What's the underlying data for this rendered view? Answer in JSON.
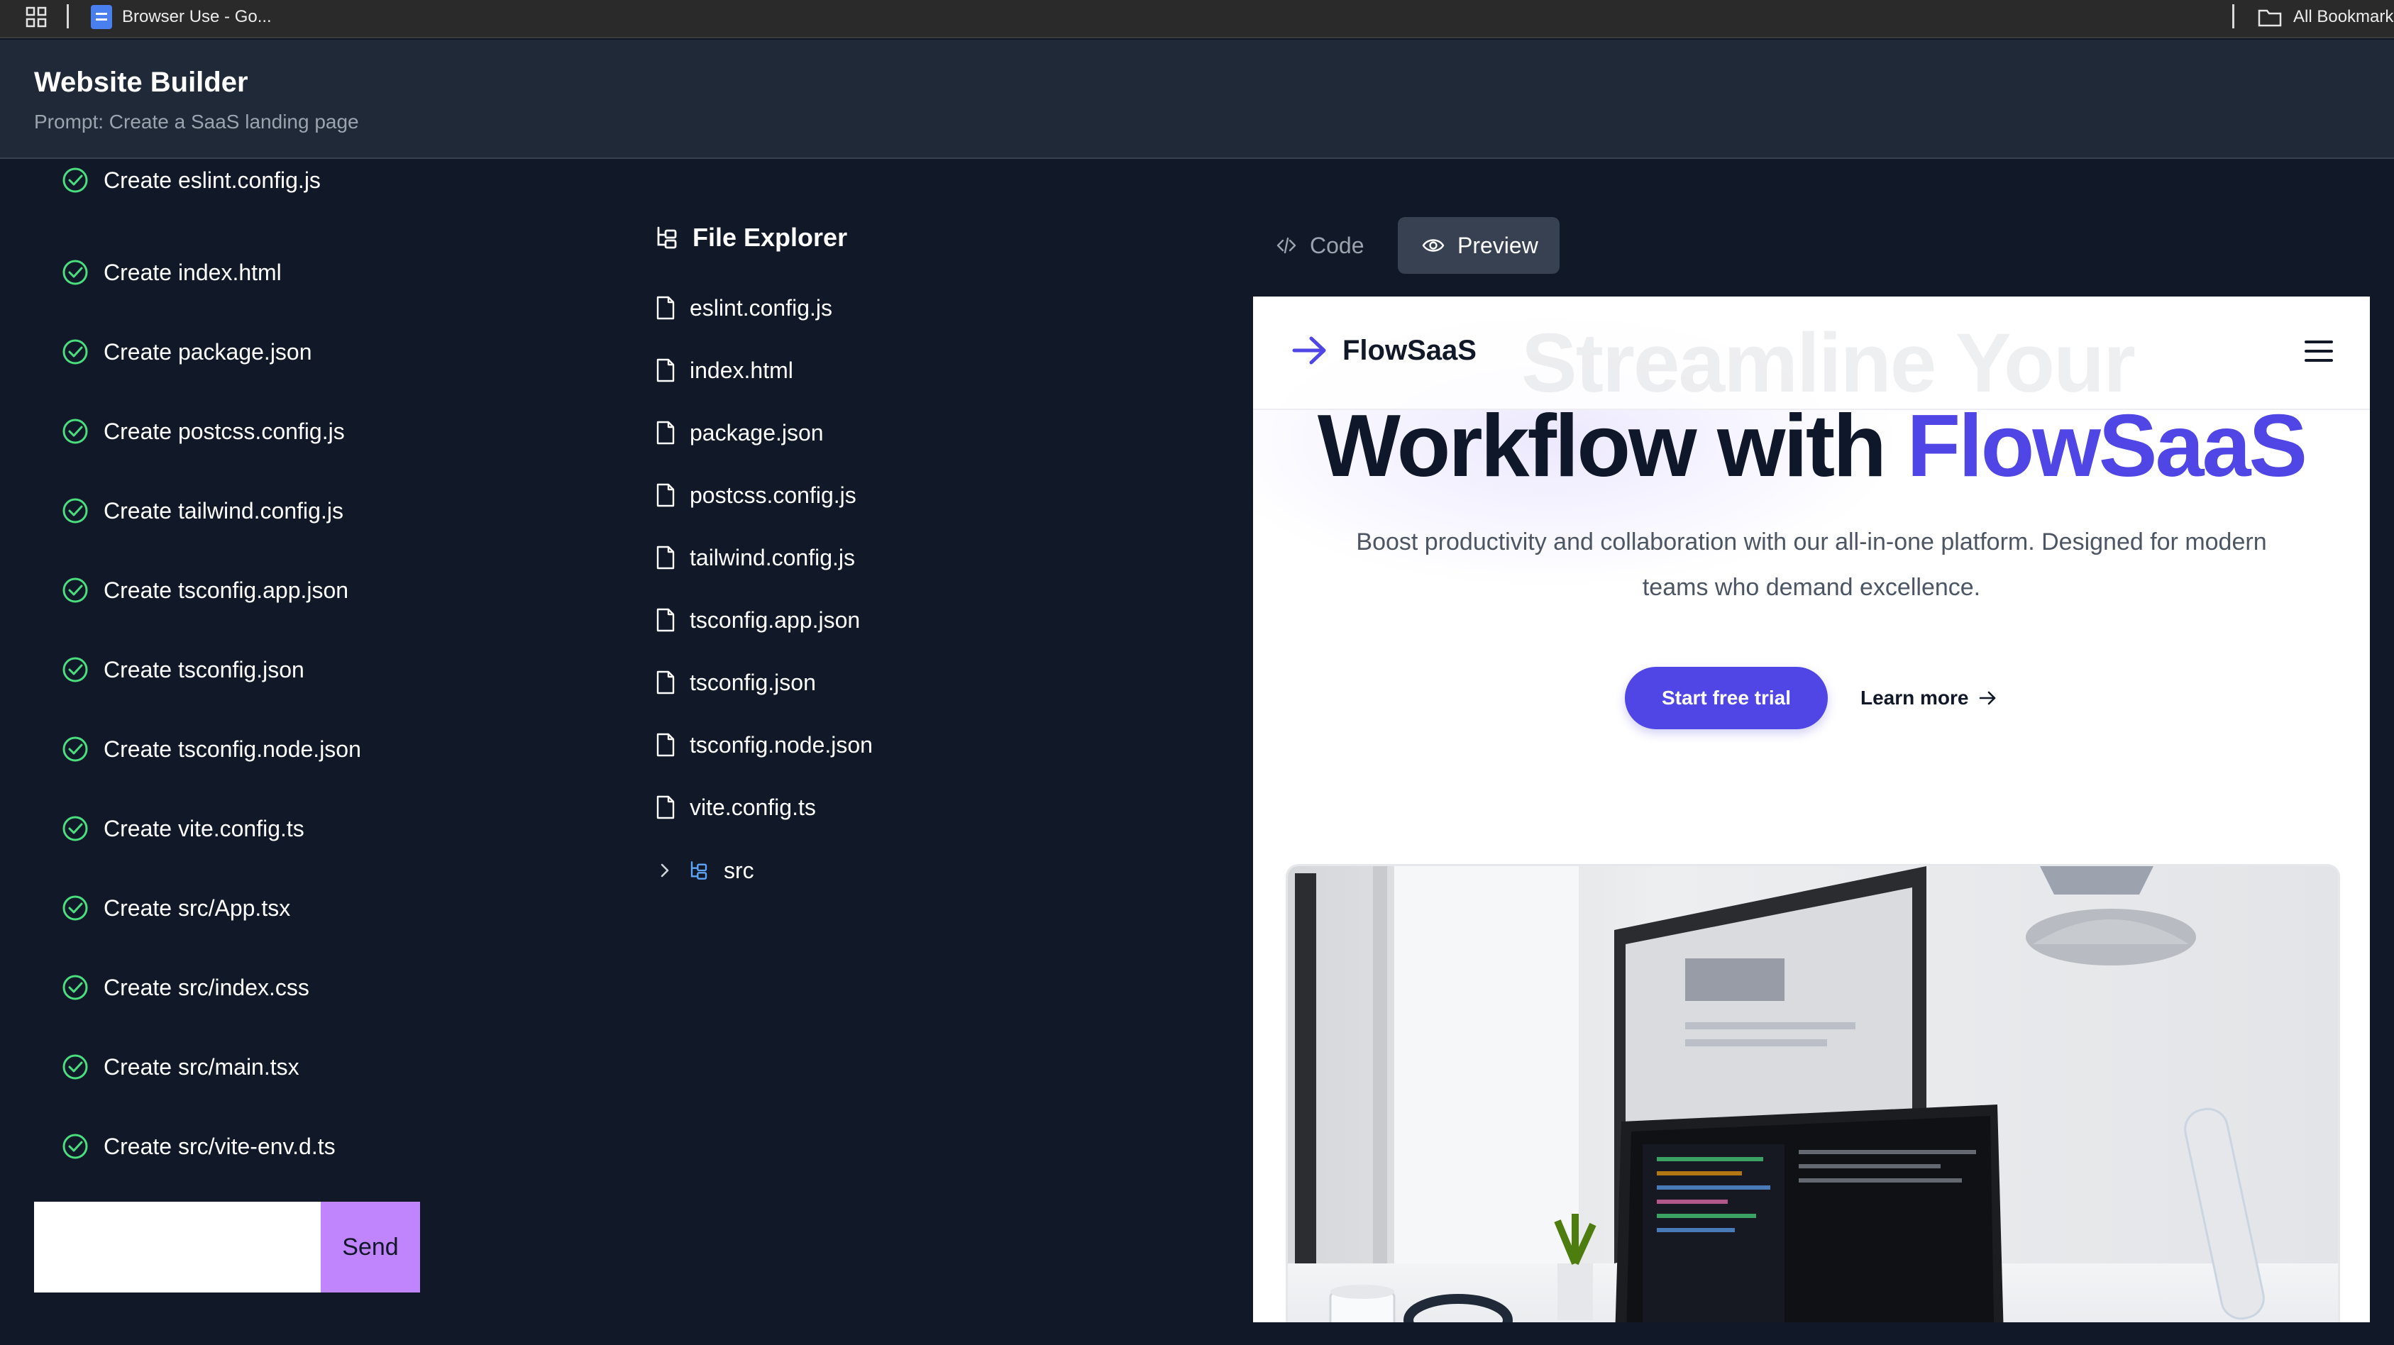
{
  "browser": {
    "bookmark_label": "Browser Use - Go...",
    "all_bookmarks_label": "All Bookmarks"
  },
  "header": {
    "title": "Website Builder",
    "prompt": "Prompt: Create a SaaS landing page"
  },
  "steps": [
    "Create eslint.config.js",
    "Create index.html",
    "Create package.json",
    "Create postcss.config.js",
    "Create tailwind.config.js",
    "Create tsconfig.app.json",
    "Create tsconfig.json",
    "Create tsconfig.node.json",
    "Create vite.config.ts",
    "Create src/App.tsx",
    "Create src/index.css",
    "Create src/main.tsx",
    "Create src/vite-env.d.ts"
  ],
  "chat": {
    "input_value": "",
    "send_label": "Send"
  },
  "file_explorer": {
    "title": "File Explorer",
    "files": [
      "eslint.config.js",
      "index.html",
      "package.json",
      "postcss.config.js",
      "tailwind.config.js",
      "tsconfig.app.json",
      "tsconfig.json",
      "tsconfig.node.json",
      "vite.config.ts"
    ],
    "folder": "src"
  },
  "tabs": {
    "code_label": "Code",
    "preview_label": "Preview",
    "active": "Preview"
  },
  "preview": {
    "brand": "FlowSaaS",
    "ghost_text": "Streamline Your",
    "headline_main": "Workflow with ",
    "headline_accent": "FlowSaaS",
    "description": "Boost productivity and collaboration with our all-in-one platform. Designed for modern teams who demand excellence.",
    "cta_primary": "Start free trial",
    "cta_secondary": "Learn more",
    "accent_color": "#4f46e5"
  },
  "colors": {
    "app_background": "#111827",
    "header_background": "#1f2937",
    "check_green": "#4ade80",
    "send_button": "#c084fc",
    "active_tab": "#374151"
  }
}
